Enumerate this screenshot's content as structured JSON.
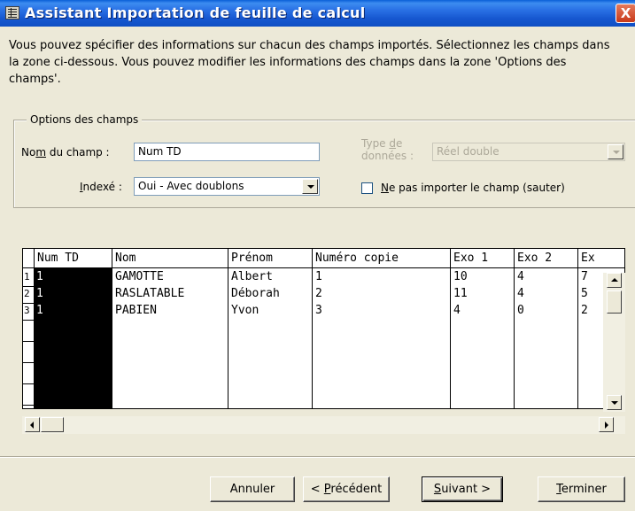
{
  "window": {
    "title": "Assistant Importation de feuille de calcul",
    "close_glyph": "X"
  },
  "description": "Vous pouvez spécifier des informations sur chacun des champs importés. Sélectionnez les champs dans la zone ci-dessous. Vous pouvez modifier les informations des champs dans la zone  'Options des champs'.",
  "options": {
    "legend": "Options des champs",
    "field_name_label": "Nom du champ :",
    "field_name_value": "Num TD",
    "data_type_label_1": "Type de",
    "data_type_label_2": "données :",
    "data_type_value": "Réel double",
    "indexed_label": "Indexé :",
    "indexed_value": "Oui - Avec doublons",
    "skip_label": "Ne pas importer le champ (sauter)",
    "skip_checked": false
  },
  "grid": {
    "columns": [
      "Num TD",
      "Nom",
      "Prénom",
      "Numéro copie",
      "Exo 1",
      "Exo 2",
      "Ex"
    ],
    "rows": [
      {
        "num": "1",
        "cells": [
          "1",
          "GAMOTTE",
          "Albert",
          "1",
          "10",
          "4",
          "7"
        ]
      },
      {
        "num": "2",
        "cells": [
          "1",
          "RASLATABLE",
          "Déborah",
          "2",
          "11",
          "4",
          "5"
        ]
      },
      {
        "num": "3",
        "cells": [
          "1",
          "PABIEN",
          "Yvon",
          "3",
          "4",
          "0",
          "2"
        ]
      }
    ],
    "selected_column": "Num TD"
  },
  "buttons": {
    "cancel": "Annuler",
    "previous": "< Précédent",
    "next": "Suivant >",
    "finish": "Terminer"
  }
}
